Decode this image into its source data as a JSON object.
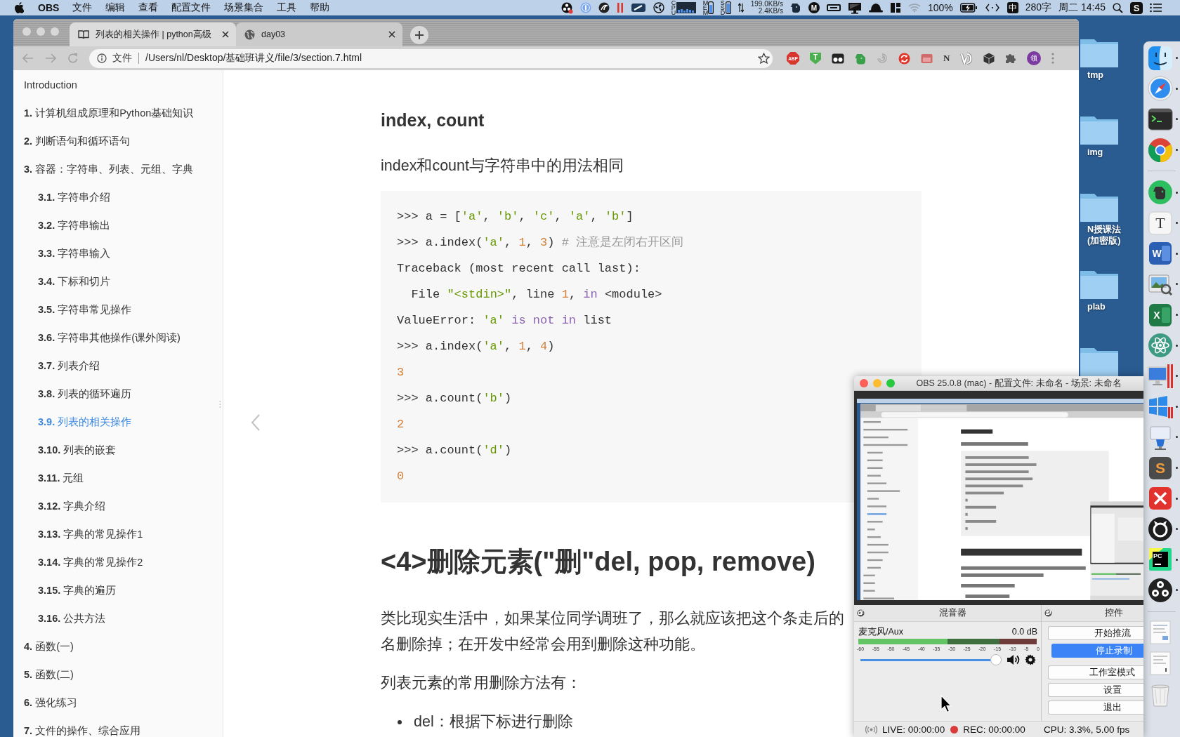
{
  "menu_bar": {
    "app": "OBS",
    "menus": [
      "文件",
      "编辑",
      "查看",
      "配置文件",
      "场景集合",
      "工具",
      "帮助"
    ],
    "meter_labels": [
      "CPU",
      "MEM",
      "SSD"
    ],
    "net_speed": [
      "199.0KB/s",
      "2.4KB/s"
    ],
    "menu_letter": "M",
    "battery": "100%",
    "input_method": "中",
    "word_count": "280字",
    "clock": "周二 14:45",
    "app_letter": "S"
  },
  "browser": {
    "tabs": [
      {
        "title": "列表的相关操作 | python高级",
        "selected": true
      },
      {
        "title": "day03",
        "selected": false
      }
    ],
    "address_label": "文件",
    "url": "/Users/nl/Desktop/基础班讲义/file/3/section.7.html",
    "extension_badges": [
      "ABP",
      "T",
      "N"
    ],
    "profile_initial": "领"
  },
  "sidebar": {
    "items": [
      {
        "title": "Introduction",
        "selected": false
      },
      {
        "number": "1.",
        "title": "计算机组成原理和Python基础知识",
        "selected": false
      },
      {
        "number": "2.",
        "title": "判断语句和循环语句",
        "selected": false
      },
      {
        "number": "3.",
        "title": "容器：字符串、列表、元组、字典",
        "selected": false,
        "children": [
          {
            "number": "3.1.",
            "title": "字符串介绍",
            "selected": false
          },
          {
            "number": "3.2.",
            "title": "字符串输出",
            "selected": false
          },
          {
            "number": "3.3.",
            "title": "字符串输入",
            "selected": false
          },
          {
            "number": "3.4.",
            "title": "下标和切片",
            "selected": false
          },
          {
            "number": "3.5.",
            "title": "字符串常见操作",
            "selected": false
          },
          {
            "number": "3.6.",
            "title": "字符串其他操作(课外阅读)",
            "selected": false
          },
          {
            "number": "3.7.",
            "title": "列表介绍",
            "selected": false
          },
          {
            "number": "3.8.",
            "title": "列表的循环遍历",
            "selected": false
          },
          {
            "number": "3.9.",
            "title": "列表的相关操作",
            "selected": true
          },
          {
            "number": "3.10.",
            "title": "列表的嵌套",
            "selected": false
          },
          {
            "number": "3.11.",
            "title": "元组",
            "selected": false
          },
          {
            "number": "3.12.",
            "title": "字典介绍",
            "selected": false
          },
          {
            "number": "3.13.",
            "title": "字典的常见操作1",
            "selected": false
          },
          {
            "number": "3.14.",
            "title": "字典的常见操作2",
            "selected": false
          },
          {
            "number": "3.15.",
            "title": "字典的遍历",
            "selected": false
          },
          {
            "number": "3.16.",
            "title": "公共方法",
            "selected": false
          }
        ]
      },
      {
        "number": "4.",
        "title": "函数(一)",
        "selected": false
      },
      {
        "number": "5.",
        "title": "函数(二)",
        "selected": false
      },
      {
        "number": "6.",
        "title": "强化练习",
        "selected": false
      },
      {
        "number": "7.",
        "title": "文件的操作、综合应用",
        "selected": false
      }
    ]
  },
  "page": {
    "heading": "index, count",
    "intro": "index和count与字符串中的用法相同",
    "code": {
      "lines": [
        {
          "tokens": [
            {
              "text": ">>> a = [",
              "kind": "plain"
            },
            {
              "text": "'a'",
              "kind": "string"
            },
            {
              "text": ", ",
              "kind": "plain"
            },
            {
              "text": "'b'",
              "kind": "string"
            },
            {
              "text": ", ",
              "kind": "plain"
            },
            {
              "text": "'c'",
              "kind": "string"
            },
            {
              "text": ", ",
              "kind": "plain"
            },
            {
              "text": "'a'",
              "kind": "string"
            },
            {
              "text": ", ",
              "kind": "plain"
            },
            {
              "text": "'b'",
              "kind": "string"
            },
            {
              "text": "]",
              "kind": "plain"
            }
          ]
        },
        {
          "tokens": [
            {
              "text": ">>> a.index(",
              "kind": "plain"
            },
            {
              "text": "'a'",
              "kind": "string"
            },
            {
              "text": ", ",
              "kind": "plain"
            },
            {
              "text": "1",
              "kind": "number"
            },
            {
              "text": ", ",
              "kind": "plain"
            },
            {
              "text": "3",
              "kind": "number"
            },
            {
              "text": ") ",
              "kind": "plain"
            },
            {
              "text": "# 注意是左闭右开区间",
              "kind": "comment"
            }
          ]
        },
        {
          "tokens": [
            {
              "text": "Traceback (most recent call last):",
              "kind": "plain"
            }
          ]
        },
        {
          "tokens": [
            {
              "text": "  File ",
              "kind": "plain"
            },
            {
              "text": "\"<stdin>\"",
              "kind": "string"
            },
            {
              "text": ", line ",
              "kind": "plain"
            },
            {
              "text": "1",
              "kind": "number"
            },
            {
              "text": ", ",
              "kind": "plain"
            },
            {
              "text": "in",
              "kind": "keyword"
            },
            {
              "text": " <module>",
              "kind": "plain"
            }
          ]
        },
        {
          "tokens": [
            {
              "text": "ValueError: ",
              "kind": "plain"
            },
            {
              "text": "'a'",
              "kind": "string"
            },
            {
              "text": " is not in",
              "kind": "keyword"
            },
            {
              "text": " list",
              "kind": "plain"
            }
          ]
        },
        {
          "tokens": [
            {
              "text": ">>> a.index(",
              "kind": "plain"
            },
            {
              "text": "'a'",
              "kind": "string"
            },
            {
              "text": ", ",
              "kind": "plain"
            },
            {
              "text": "1",
              "kind": "number"
            },
            {
              "text": ", ",
              "kind": "plain"
            },
            {
              "text": "4",
              "kind": "number"
            },
            {
              "text": ")",
              "kind": "plain"
            }
          ]
        },
        {
          "tokens": [
            {
              "text": "3",
              "kind": "number"
            }
          ]
        },
        {
          "tokens": [
            {
              "text": ">>> a.count(",
              "kind": "plain"
            },
            {
              "text": "'b'",
              "kind": "string"
            },
            {
              "text": ")",
              "kind": "plain"
            }
          ]
        },
        {
          "tokens": [
            {
              "text": "2",
              "kind": "number"
            }
          ]
        },
        {
          "tokens": [
            {
              "text": ">>> a.count(",
              "kind": "plain"
            },
            {
              "text": "'d'",
              "kind": "string"
            },
            {
              "text": ")",
              "kind": "plain"
            }
          ]
        },
        {
          "tokens": [
            {
              "text": "0",
              "kind": "number"
            }
          ]
        }
      ]
    },
    "section_heading": "<4>删除元素(\"删\"del, pop, remove)",
    "paragraph_lines": [
      "类比现实生活中，如果某位同学调班了，那么就应该把这个条走后的",
      "名删除掉；在开发中经常会用到删除这种功能。"
    ],
    "list_intro": "列表元素的常用删除方法有：",
    "bullets": [
      "del：根据下标进行删除"
    ]
  },
  "desktop": {
    "folders": [
      {
        "label": "tmp"
      },
      {
        "label": "img"
      },
      {
        "label": "N授课法 (加密版)"
      },
      {
        "label": "plab"
      }
    ]
  },
  "dock": {
    "sections": [
      {
        "apps": [
          {
            "running": true
          },
          {
            "running": true
          },
          {
            "running": true
          },
          {
            "running": true
          }
        ]
      },
      {
        "apps": [
          {
            "running": true
          },
          {
            "running": true,
            "label": "T"
          },
          {
            "running": true,
            "label": "W"
          },
          {
            "running": true
          },
          {
            "running": true,
            "label": "X"
          },
          {
            "running": true
          },
          {
            "running": true
          },
          {
            "running": true
          },
          {
            "running": true
          },
          {
            "running": true,
            "label": "S"
          },
          {
            "running": true
          },
          {
            "running": true
          },
          {
            "running": true,
            "label": "PC"
          },
          {
            "running": true
          }
        ]
      }
    ]
  },
  "obs_window": {
    "title": "OBS 25.0.8 (mac) - 配置文件: 未命名 - 场景: 未命名",
    "mixer": {
      "title": "混音器",
      "channels": [
        {
          "name": "麦克风/Aux",
          "reading": "0.0 dB",
          "muted": false,
          "meter": {
            "level": 0.5,
            "scale": [
              "-60",
              "-55",
              "-50",
              "-45",
              "-40",
              "-35",
              "-30",
              "-25",
              "-20",
              "-15",
              "-10",
              "-5",
              "0"
            ]
          },
          "volume": {
            "level": 1
          }
        }
      ]
    },
    "controls": {
      "title": "控件",
      "buttons": [
        {
          "label": "开始推流",
          "on": false
        },
        {
          "label": "停止录制",
          "on": true
        },
        {
          "label": "工作室模式",
          "on": false
        },
        {
          "label": "设置",
          "on": false
        },
        {
          "label": "退出",
          "on": false
        }
      ]
    },
    "status": {
      "live": "LIVE: 00:00:00",
      "rec": "REC: 00:00:00",
      "cpu": "CPU: 3.3%, 5.00 fps"
    }
  }
}
